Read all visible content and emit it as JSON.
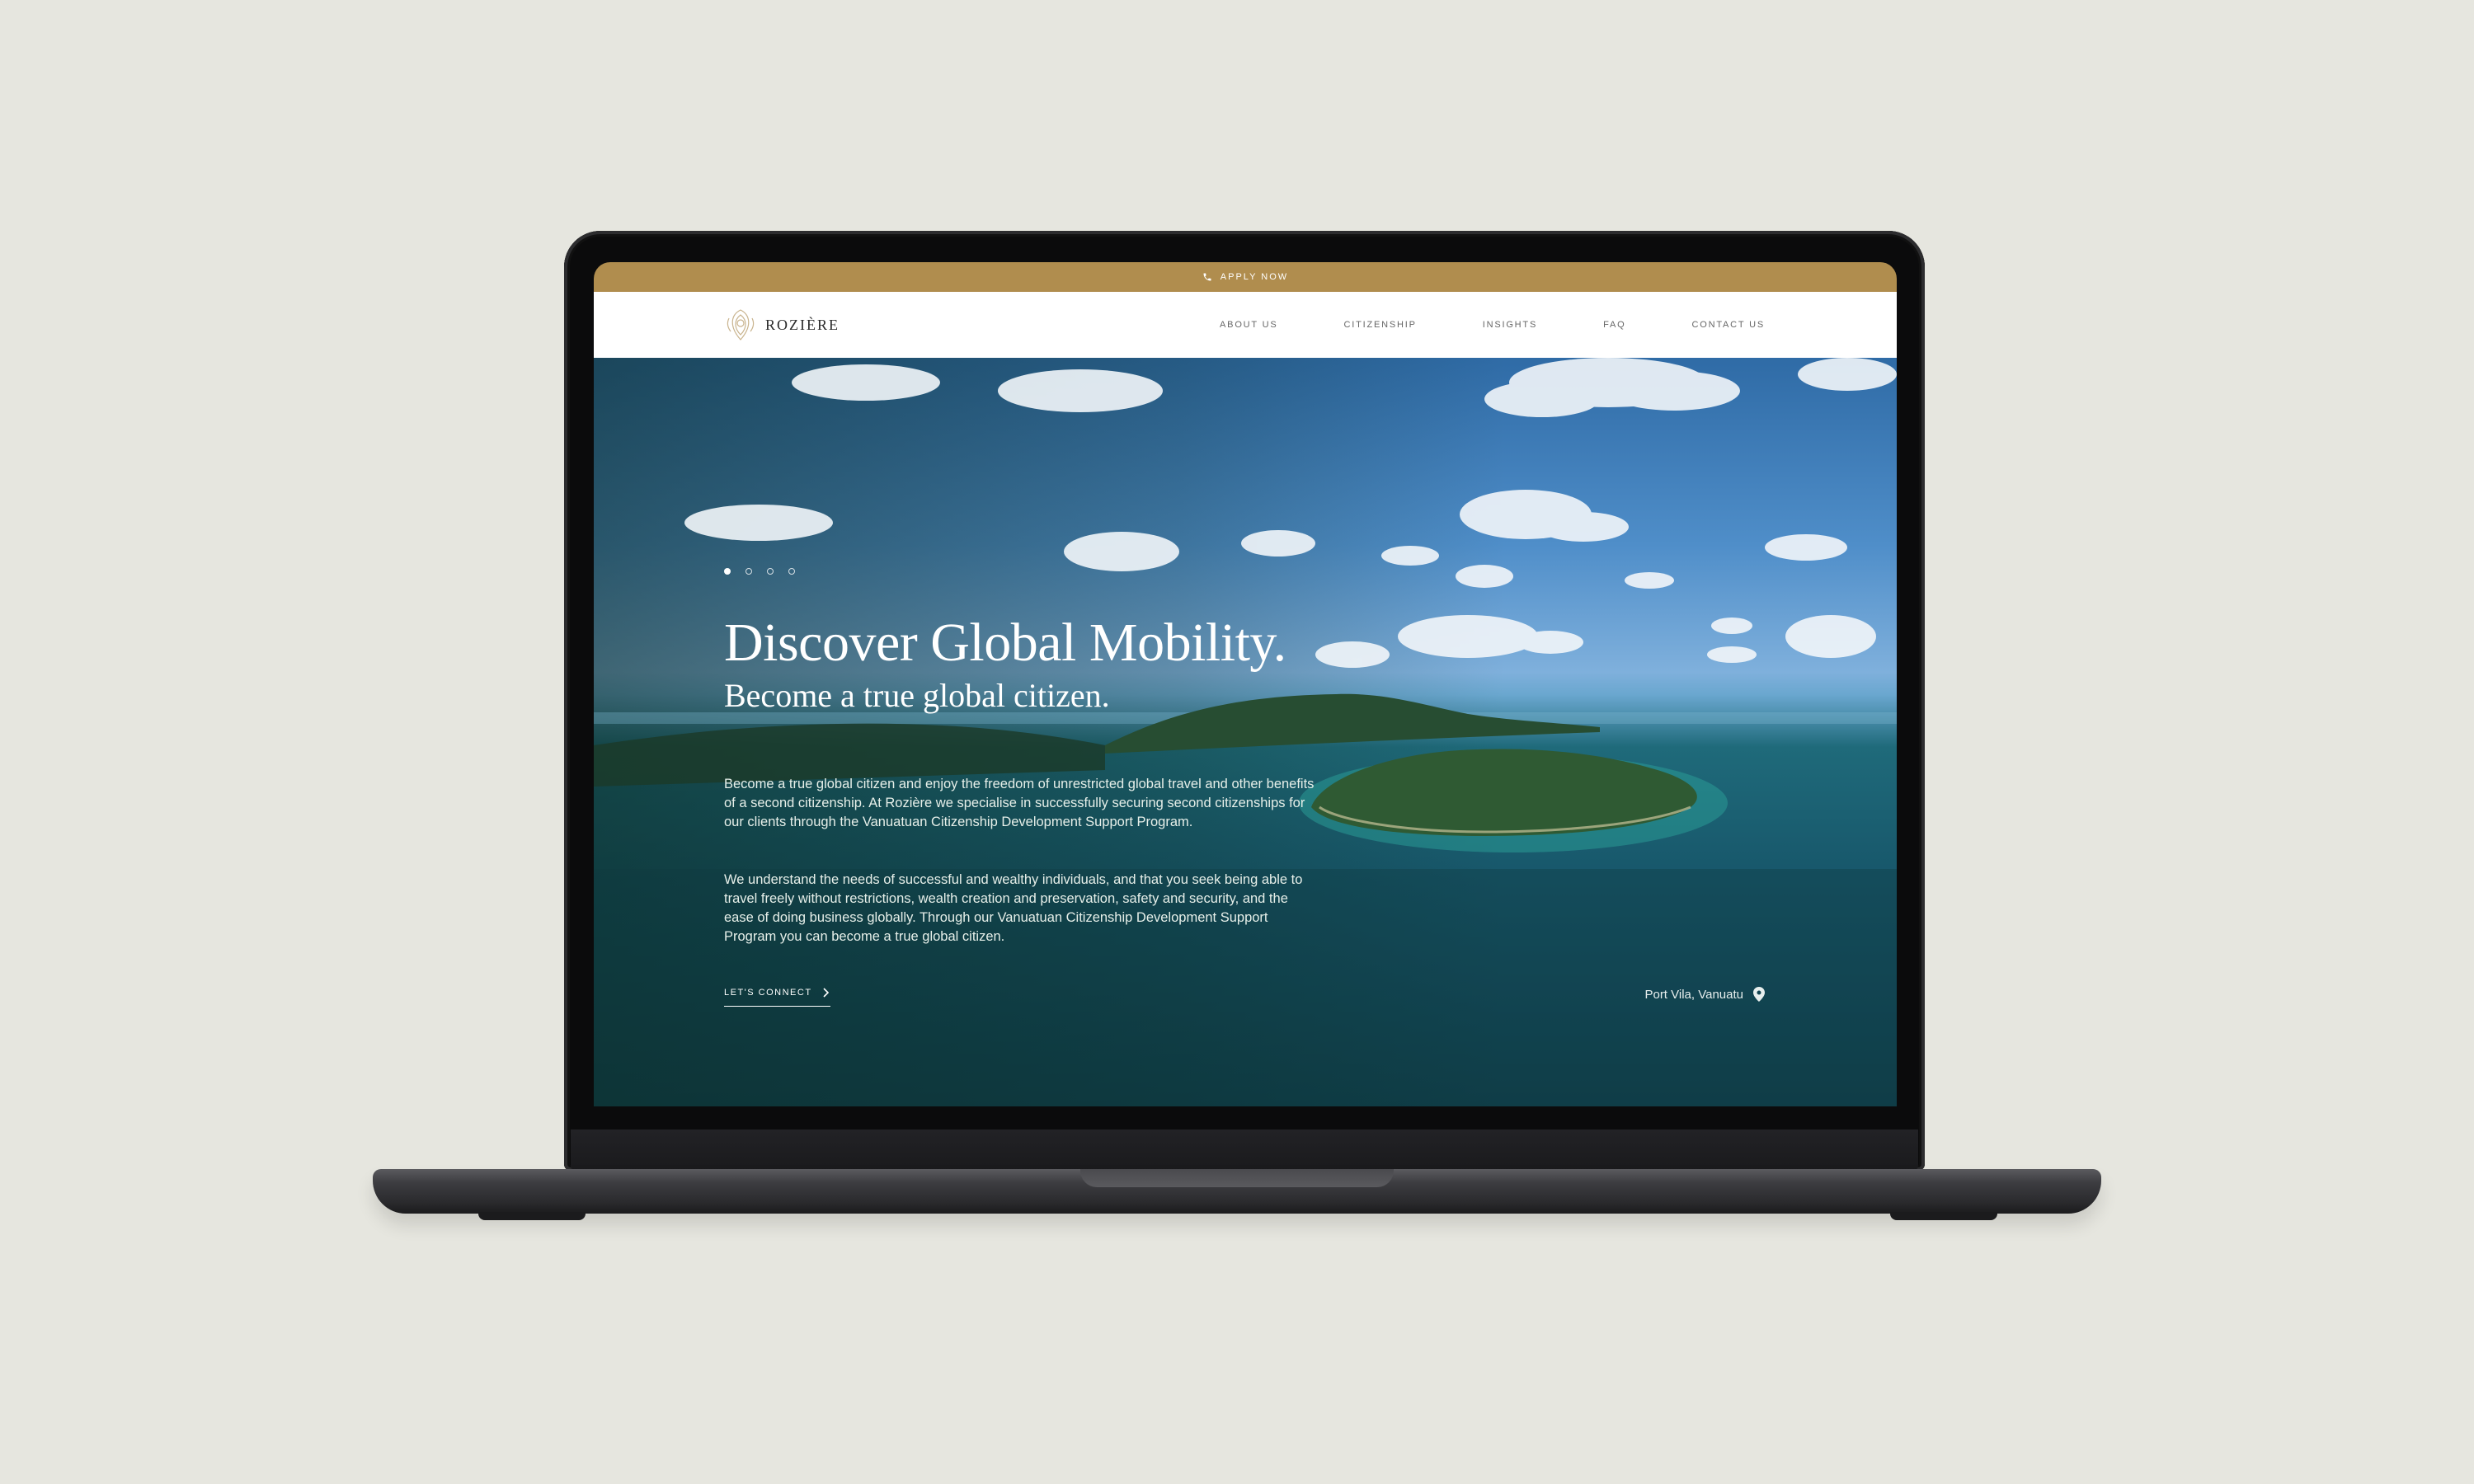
{
  "topbar": {
    "label": "APPLY NOW",
    "icon": "phone-icon"
  },
  "brand": {
    "name": "ROZIÈRE",
    "icon": "crest-logo-icon"
  },
  "nav": {
    "items": [
      "ABOUT US",
      "CITIZENSHIP",
      "INSIGHTS",
      "FAQ",
      "CONTACT US"
    ]
  },
  "hero": {
    "title": "Discover Global Mobility.",
    "subtitle": "Become a true global citizen.",
    "paragraph1": "Become a true global citizen and enjoy the freedom of unrestricted global travel and other benefits of a second citizenship.  At Rozière we specialise in successfully securing second citizenships for our clients through the Vanuatuan Citizenship Development Support Program.",
    "paragraph2": "We understand the needs of successful and wealthy individuals, and that you seek being able to travel freely without restrictions, wealth creation and preservation, safety and security, and the ease of doing business globally.  Through our Vanuatuan Citizenship Development Support Program you can become a true global citizen.",
    "cta": "LET'S CONNECT",
    "location": "Port Vila, Vanuatu",
    "slide_count": 4,
    "active_slide": 1
  },
  "colors": {
    "accent": "#b08d4e",
    "background": "#e6e6df"
  }
}
